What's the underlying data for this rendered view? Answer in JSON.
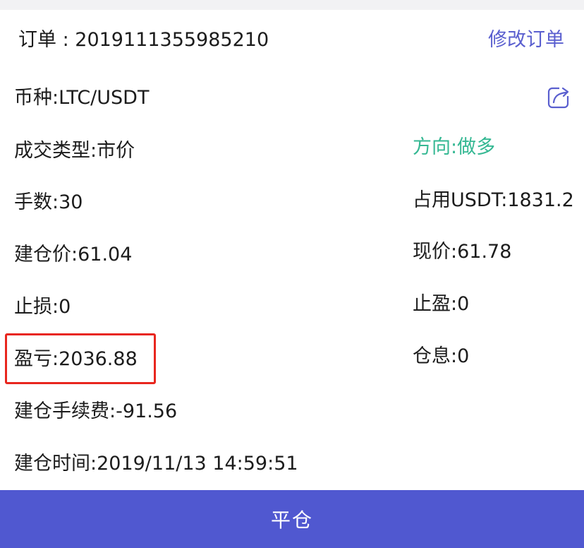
{
  "order": {
    "label": "订单 : ",
    "number": "2019111355985210",
    "edit_label": "修改订单"
  },
  "fields": {
    "coin": "币种:LTC/USDT",
    "trade_type": "成交类型:市价",
    "direction": "方向:做多",
    "lots": "手数:30",
    "occupied": "占用USDT:1831.2",
    "open_price": "建仓价:61.04",
    "current_price": "现价:61.78",
    "stop_loss": "止损:0",
    "take_profit": "止盈:0",
    "profit_loss": "盈亏:2036.88",
    "swap": "仓息:0",
    "open_fee": "建仓手续费:-91.56",
    "open_time": "建仓时间:2019/11/13 14:59:51"
  },
  "colors": {
    "accent": "#5058d0",
    "link": "#5a5fcf",
    "direction_long": "#35b893",
    "highlight": "#e8261e"
  },
  "icons": {
    "share": "share-icon"
  },
  "action": {
    "close_position_label": "平仓"
  }
}
